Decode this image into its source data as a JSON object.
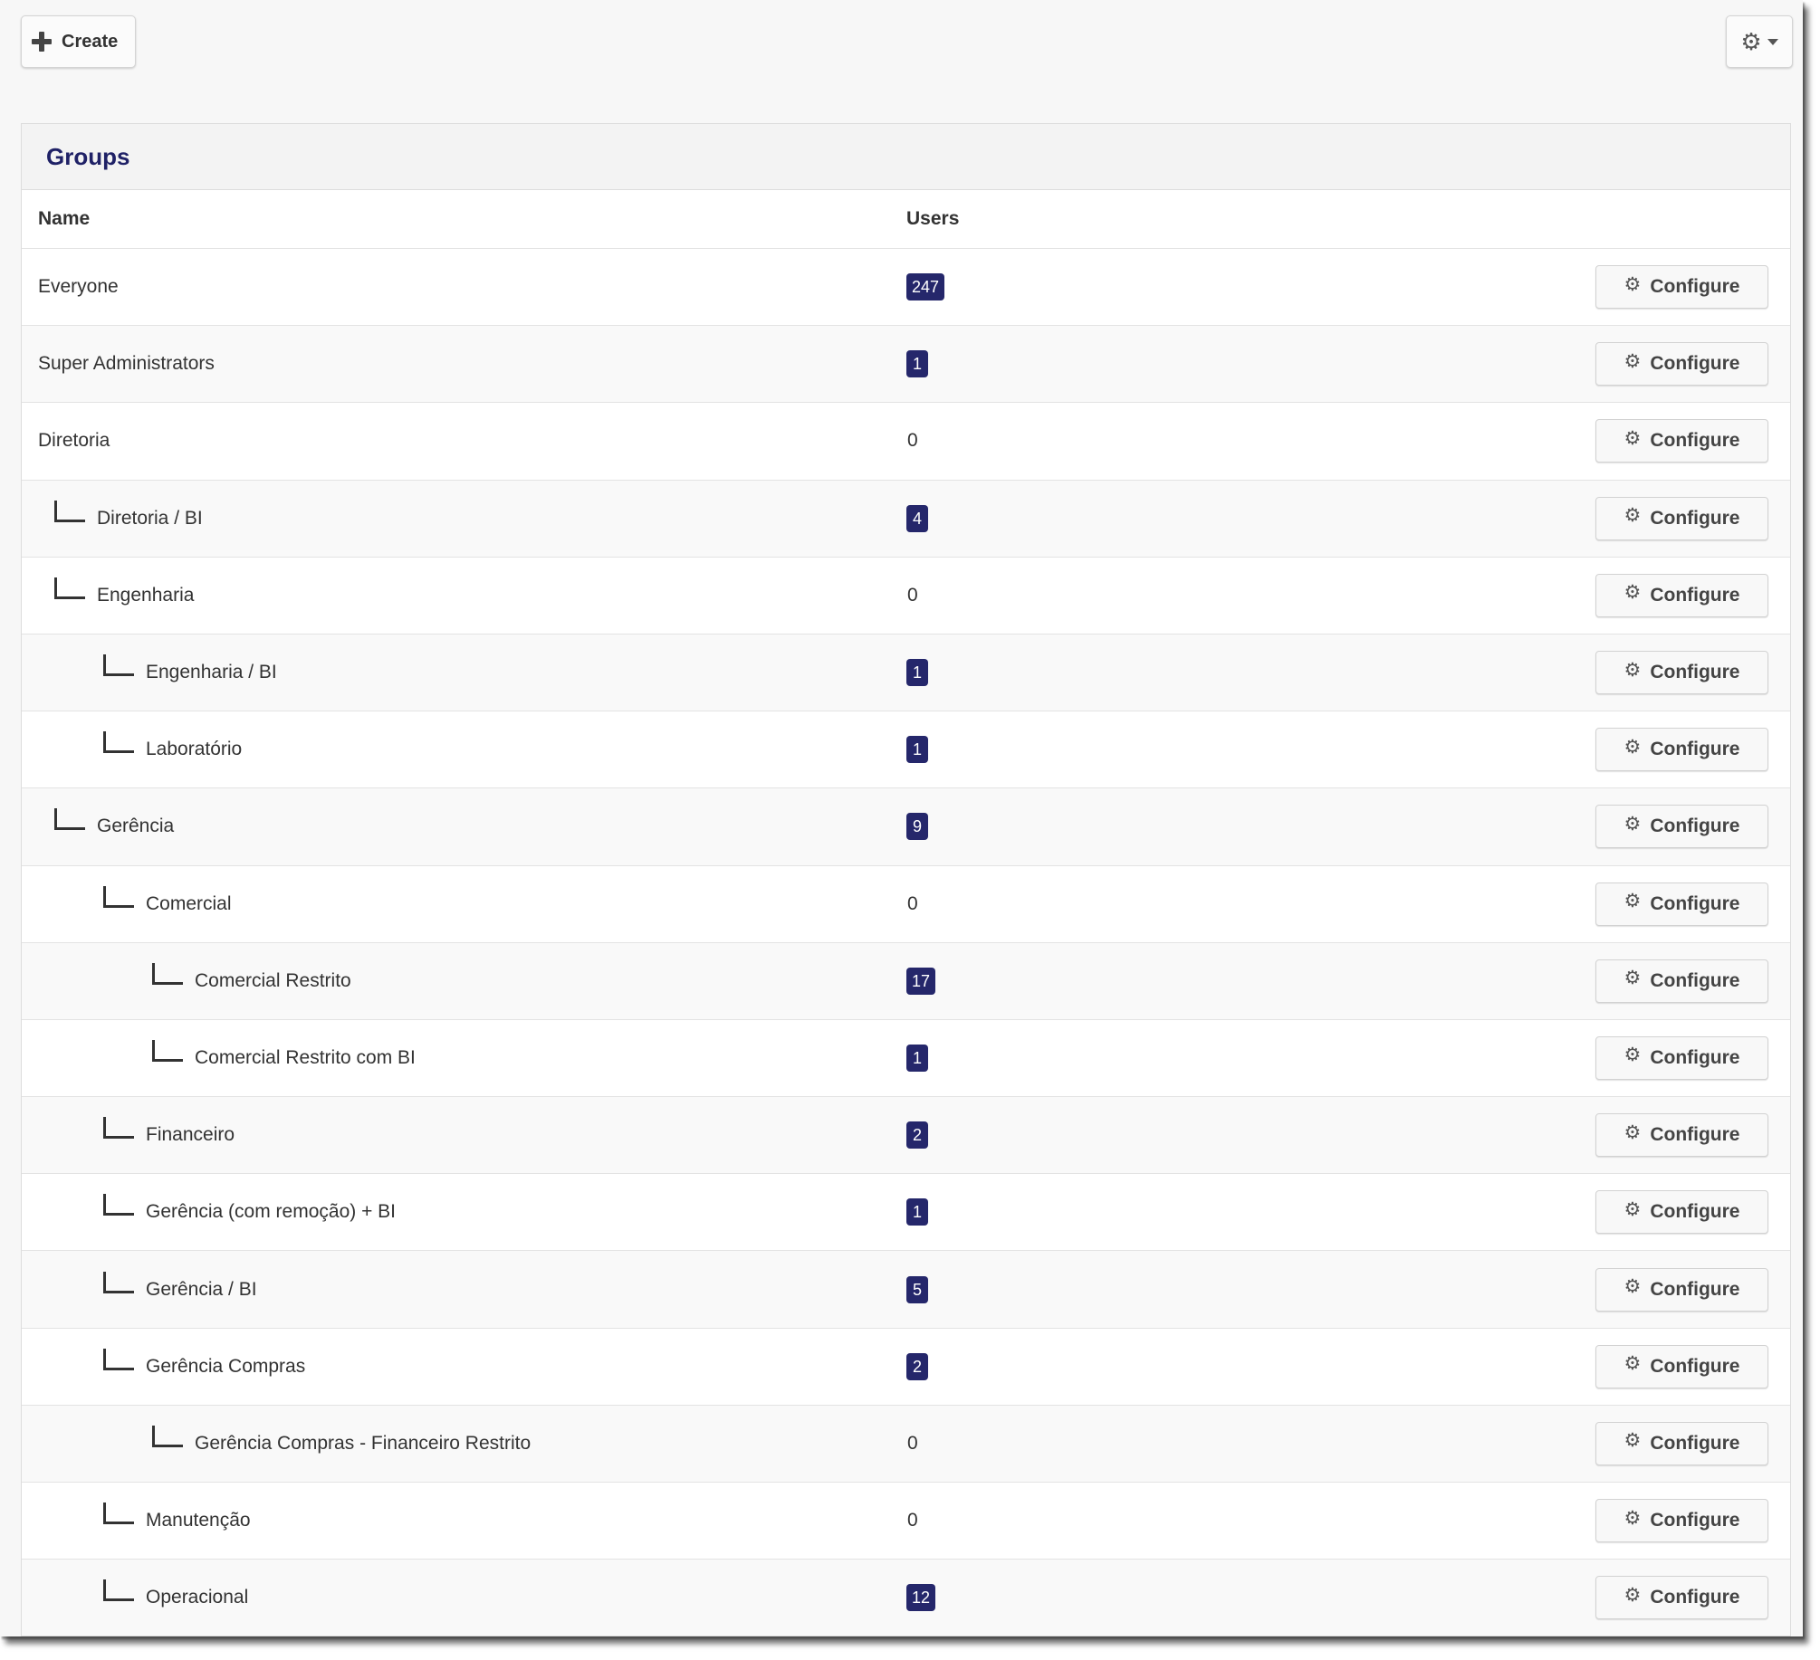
{
  "toolbar": {
    "create_label": "Create",
    "create_icon": "plus-icon",
    "settings_icon": "gear-icon"
  },
  "panel": {
    "title": "Groups",
    "columns": {
      "name": "Name",
      "users": "Users"
    }
  },
  "configure_label": "Configure",
  "badge_color": "#25276b",
  "title_color": "#1f2166",
  "groups": [
    {
      "name": "Everyone",
      "depth": 0,
      "users": "247",
      "badge": true
    },
    {
      "name": "Super Administrators",
      "depth": 0,
      "users": "1",
      "badge": true
    },
    {
      "name": "Diretoria",
      "depth": 0,
      "users": "0",
      "badge": false
    },
    {
      "name": "Diretoria / BI",
      "depth": 1,
      "users": "4",
      "badge": true
    },
    {
      "name": "Engenharia",
      "depth": 1,
      "users": "0",
      "badge": false
    },
    {
      "name": "Engenharia / BI",
      "depth": 2,
      "users": "1",
      "badge": true
    },
    {
      "name": "Laboratório",
      "depth": 2,
      "users": "1",
      "badge": true
    },
    {
      "name": "Gerência",
      "depth": 1,
      "users": "9",
      "badge": true
    },
    {
      "name": "Comercial",
      "depth": 2,
      "users": "0",
      "badge": false
    },
    {
      "name": "Comercial Restrito",
      "depth": 3,
      "users": "17",
      "badge": true
    },
    {
      "name": "Comercial Restrito com BI",
      "depth": 3,
      "users": "1",
      "badge": true
    },
    {
      "name": "Financeiro",
      "depth": 2,
      "users": "2",
      "badge": true
    },
    {
      "name": "Gerência (com remoção) + BI",
      "depth": 2,
      "users": "1",
      "badge": true
    },
    {
      "name": "Gerência / BI",
      "depth": 2,
      "users": "5",
      "badge": true
    },
    {
      "name": "Gerência Compras",
      "depth": 2,
      "users": "2",
      "badge": true
    },
    {
      "name": "Gerência Compras - Financeiro Restrito",
      "depth": 3,
      "users": "0",
      "badge": false
    },
    {
      "name": "Manutenção",
      "depth": 2,
      "users": "0",
      "badge": false
    },
    {
      "name": "Operacional",
      "depth": 2,
      "users": "12",
      "badge": true
    }
  ]
}
